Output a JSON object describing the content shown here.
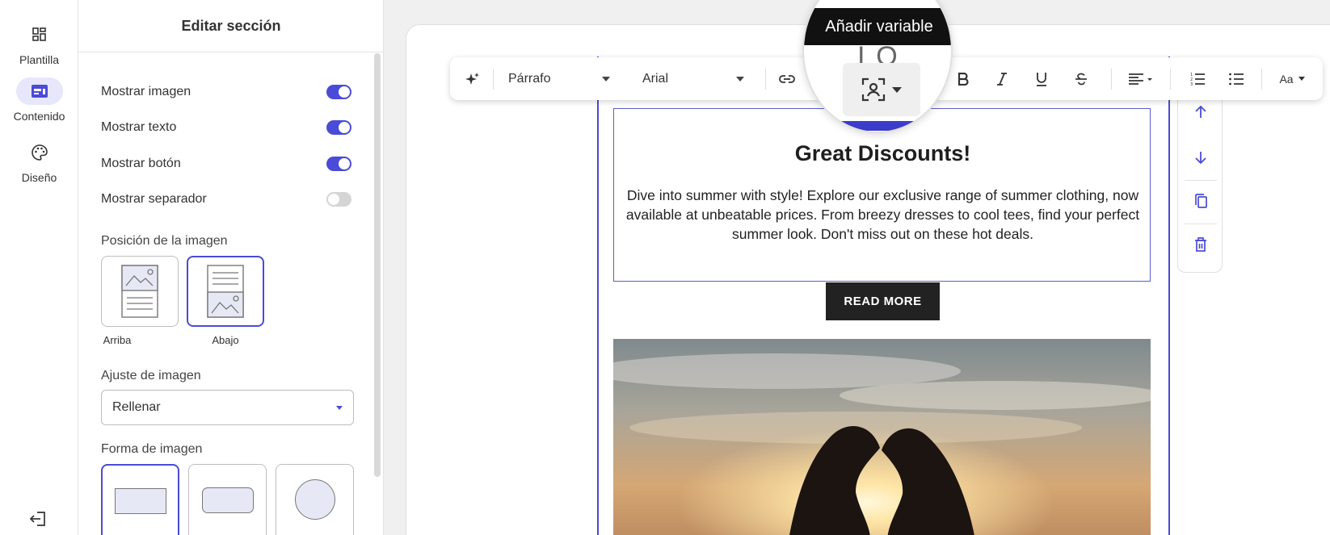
{
  "nav": {
    "items": [
      {
        "label": "Plantilla",
        "icon": "grid-icon"
      },
      {
        "label": "Contenido",
        "icon": "layout-icon",
        "active": true
      },
      {
        "label": "Diseño",
        "icon": "palette-icon"
      }
    ],
    "exit_icon": "exit-icon"
  },
  "panel": {
    "title": "Editar sección",
    "toggles": [
      {
        "label": "Mostrar imagen",
        "on": true
      },
      {
        "label": "Mostrar texto",
        "on": true
      },
      {
        "label": "Mostrar botón",
        "on": true
      },
      {
        "label": "Mostrar separador",
        "on": false
      }
    ],
    "image_position": {
      "label": "Posición de la imagen",
      "options": [
        {
          "label": "Arriba",
          "selected": false
        },
        {
          "label": "Abajo",
          "selected": true
        }
      ]
    },
    "image_fit": {
      "label": "Ajuste de imagen",
      "value": "Rellenar"
    },
    "image_shape": {
      "label": "Forma de imagen",
      "options": [
        {
          "shape": "rectangle",
          "selected": true
        },
        {
          "shape": "rounded-rectangle",
          "selected": false
        },
        {
          "shape": "circle",
          "selected": false
        }
      ]
    }
  },
  "toolbar": {
    "paragraph_style": "Párrafo",
    "font": "Arial",
    "size_label": "Aa"
  },
  "magnifier": {
    "tooltip": "Añadir variable",
    "logo_text": "OUR (  ) LO"
  },
  "email": {
    "heading": "Great Discounts!",
    "body": "Dive into summer with style! Explore our exclusive range of summer clothing, now available at unbeatable prices. From breezy dresses to cool tees, find your perfect summer look. Don't miss out on these hot deals.",
    "button": "READ MORE"
  },
  "colors": {
    "accent": "#4a4bd7",
    "accent_light": "#e6e7fb",
    "button_bg": "#222222"
  }
}
